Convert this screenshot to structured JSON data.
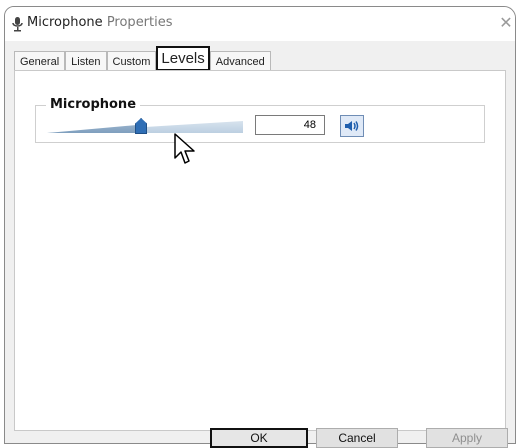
{
  "window": {
    "title_main": "Microphone",
    "title_rest": "Properties",
    "close_glyph": "✕"
  },
  "tabs": [
    {
      "label": "General"
    },
    {
      "label": "Listen"
    },
    {
      "label": "Custom"
    },
    {
      "label": "Levels"
    },
    {
      "label": "Advanced"
    }
  ],
  "levels": {
    "group_label": "Microphone",
    "level_value": "48",
    "slider_fraction": 0.48
  },
  "buttons": {
    "ok": "OK",
    "cancel": "Cancel",
    "apply": "Apply"
  },
  "colors": {
    "accent": "#2f6eb5",
    "selected_border": "#111111"
  },
  "icons": {
    "title": "microphone-icon",
    "speaker": "speaker-icon",
    "cursor": "mouse-pointer-icon"
  }
}
